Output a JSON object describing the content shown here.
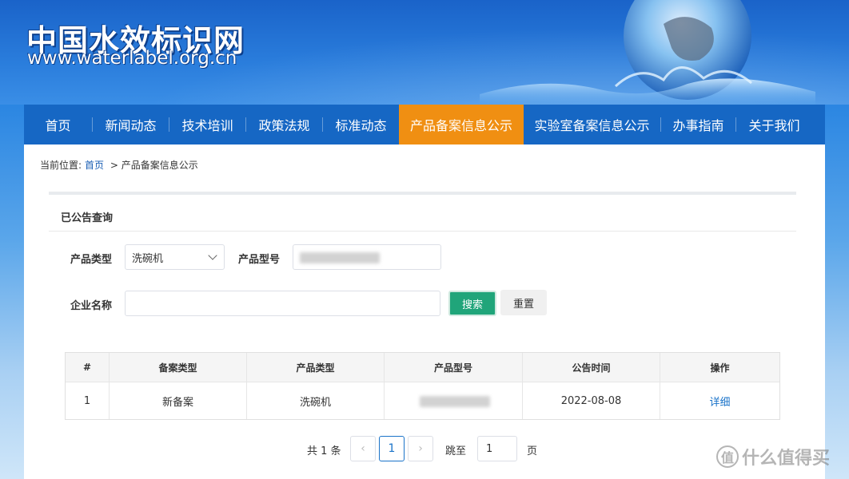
{
  "header": {
    "logo_title": "中国水效标识网",
    "logo_url": "www.waterlabel.org.cn"
  },
  "nav": {
    "items": [
      {
        "label": "首页"
      },
      {
        "label": "新闻动态"
      },
      {
        "label": "技术培训"
      },
      {
        "label": "政策法规"
      },
      {
        "label": "标准动态"
      },
      {
        "label": "产品备案信息公示"
      },
      {
        "label": "实验室备案信息公示"
      },
      {
        "label": "办事指南"
      },
      {
        "label": "关于我们"
      }
    ],
    "active_index": 5,
    "active_color": "#f08f12",
    "bar_color": "#1667c4"
  },
  "breadcrumb": {
    "prefix": "当前位置:",
    "home": "首页",
    "current": "> 产品备案信息公示"
  },
  "section_title": "已公告查询",
  "form": {
    "product_type_label": "产品类型",
    "product_type_value": "洗碗机",
    "product_model_label": "产品型号",
    "company_label": "企业名称",
    "search_label": "搜索",
    "reset_label": "重置"
  },
  "table": {
    "headers": [
      "#",
      "备案类型",
      "产品类型",
      "产品型号",
      "公告时间",
      "操作"
    ],
    "rows": [
      {
        "index": "1",
        "record_type": "新备案",
        "product_type": "洗碗机",
        "product_model": "",
        "date": "2022-08-08",
        "action": "详细"
      }
    ]
  },
  "pagination": {
    "total": "共 1 条",
    "prev": "‹",
    "current_page": "1",
    "next": "›",
    "goto_label": "跳至",
    "goto_value": "1",
    "page_suffix": "页"
  },
  "watermark": {
    "icon": "值",
    "text": "什么值得买"
  },
  "colors": {
    "search_button": "#20a57a",
    "link": "#1a73c9"
  }
}
